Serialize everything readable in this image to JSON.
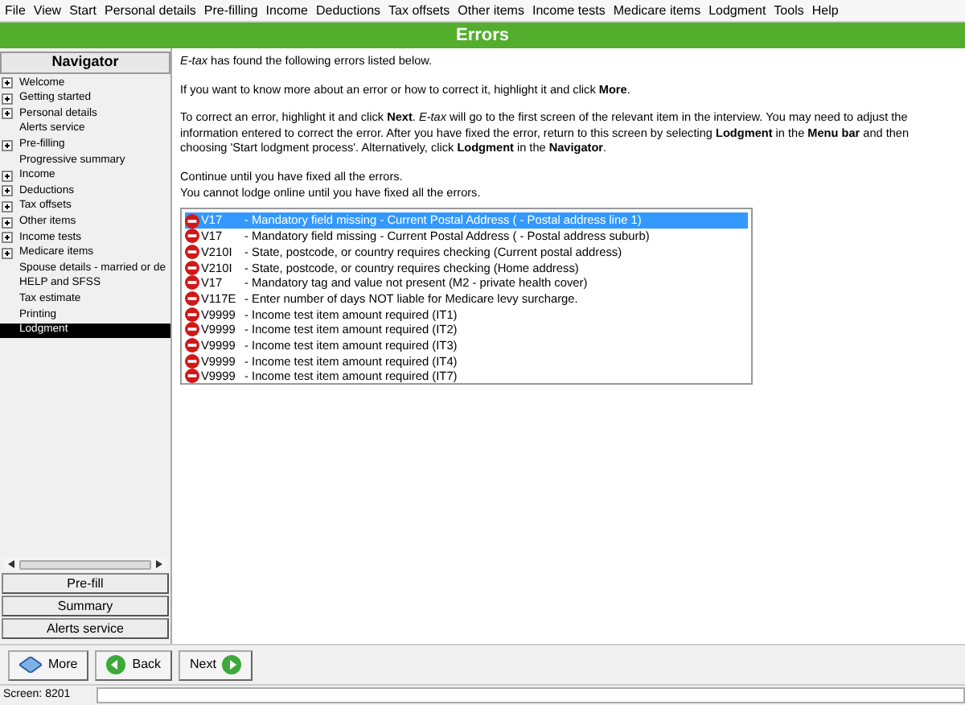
{
  "menu": [
    "File",
    "View",
    "Start",
    "Personal details",
    "Pre-filling",
    "Income",
    "Deductions",
    "Tax offsets",
    "Other items",
    "Income tests",
    "Medicare items",
    "Lodgment",
    "Tools",
    "Help"
  ],
  "title": "Errors",
  "navigator": {
    "title": "Navigator",
    "items": [
      {
        "label": "Welcome",
        "expandable": true,
        "selected": false
      },
      {
        "label": "Getting started",
        "expandable": true,
        "selected": false
      },
      {
        "label": "Personal details",
        "expandable": true,
        "selected": false
      },
      {
        "label": "Alerts service",
        "expandable": false,
        "selected": false
      },
      {
        "label": "Pre-filling",
        "expandable": true,
        "selected": false
      },
      {
        "label": "Progressive summary",
        "expandable": false,
        "selected": false
      },
      {
        "label": "Income",
        "expandable": true,
        "selected": false
      },
      {
        "label": "Deductions",
        "expandable": true,
        "selected": false
      },
      {
        "label": "Tax offsets",
        "expandable": true,
        "selected": false
      },
      {
        "label": "Other items",
        "expandable": true,
        "selected": false
      },
      {
        "label": "Income tests",
        "expandable": true,
        "selected": false
      },
      {
        "label": "Medicare items",
        "expandable": true,
        "selected": false
      },
      {
        "label": "Spouse details - married or de",
        "expandable": false,
        "selected": false
      },
      {
        "label": "HELP and SFSS",
        "expandable": false,
        "selected": false
      },
      {
        "label": "Tax estimate",
        "expandable": false,
        "selected": false
      },
      {
        "label": "Printing",
        "expandable": false,
        "selected": false
      },
      {
        "label": "Lodgment",
        "expandable": false,
        "selected": true
      }
    ],
    "buttons": [
      "Pre-fill",
      "Summary",
      "Alerts service"
    ]
  },
  "paragraphs": [
    [
      "*E-tax* has found the following errors listed below."
    ],
    [
      "If you want to know more about an error or how to correct it, highlight it and click **More**."
    ],
    [
      "To correct an error, highlight it and click **Next**. *E-tax* will go to the first screen of the relevant item in the interview. You may need to adjust the information entered to correct the error. After you have fixed the error, return to this screen by selecting **Lodgment** in the **Menu bar** and then choosing 'Start lodgment process'. Alternatively, click **Lodgment** in the **Navigator**."
    ],
    [
      "Continue until you have fixed all the errors.",
      "You cannot lodge online until you have fixed all the errors."
    ]
  ],
  "errors": [
    {
      "code": "V17",
      "message": "- Mandatory field missing - Current Postal Address ( - Postal address line 1)",
      "selected": true
    },
    {
      "code": "V17",
      "message": "- Mandatory field missing - Current Postal Address ( - Postal address suburb)",
      "selected": false
    },
    {
      "code": "V210I",
      "message": "- State, postcode, or country requires checking (Current postal address)",
      "selected": false
    },
    {
      "code": "V210I",
      "message": "- State, postcode, or country requires checking (Home address)",
      "selected": false
    },
    {
      "code": "V17",
      "message": "- Mandatory tag and value not present (M2 - private health cover)",
      "selected": false
    },
    {
      "code": "V117E",
      "message": "- Enter number of days NOT liable for Medicare levy surcharge.",
      "selected": false
    },
    {
      "code": "V9999",
      "message": "- Income test item amount required (IT1)",
      "selected": false
    },
    {
      "code": "V9999",
      "message": "- Income test item amount required (IT2)",
      "selected": false
    },
    {
      "code": "V9999",
      "message": "- Income test item amount required (IT3)",
      "selected": false
    },
    {
      "code": "V9999",
      "message": "- Income test item amount required (IT4)",
      "selected": false
    },
    {
      "code": "V9999",
      "message": "- Income test item amount required (IT7)",
      "selected": false
    }
  ],
  "toolbar": [
    {
      "label": "More",
      "kind": "more"
    },
    {
      "label": "Back",
      "kind": "back"
    },
    {
      "label": "Next",
      "kind": "next"
    }
  ],
  "status_bar": "Screen: 8201"
}
